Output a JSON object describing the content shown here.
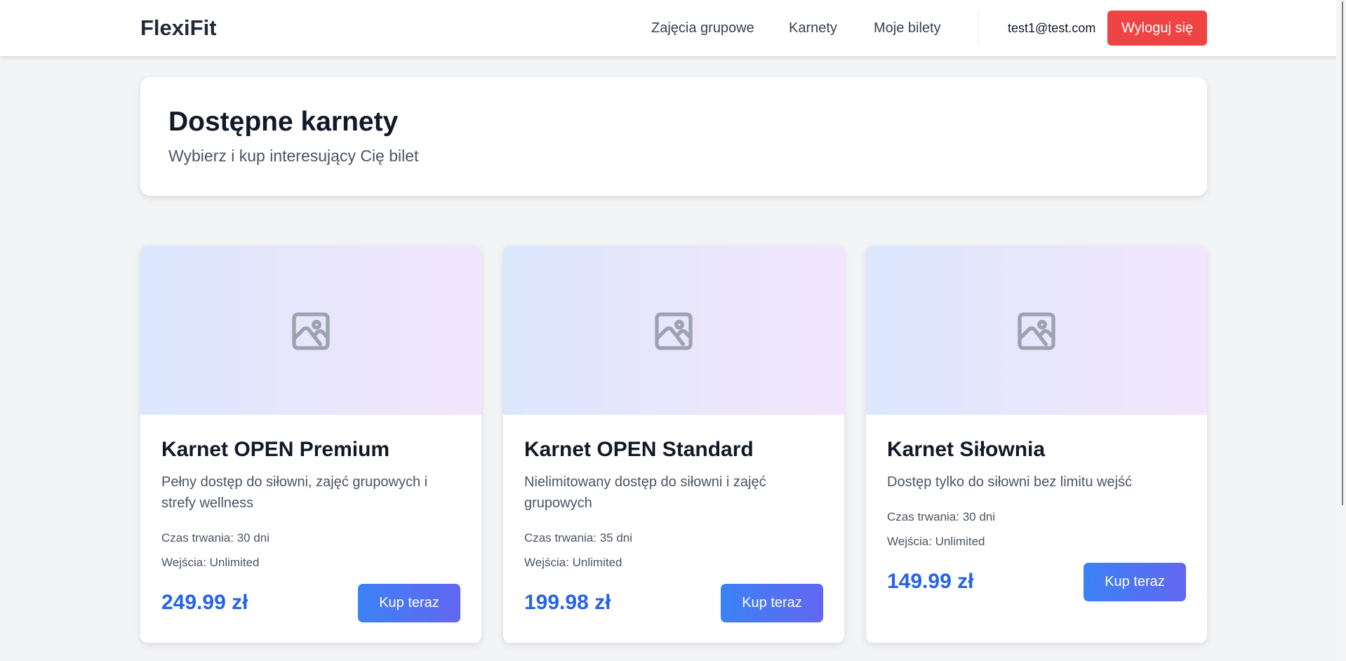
{
  "navbar": {
    "brand": "FlexiFit",
    "links": [
      {
        "label": "Zajęcia grupowe"
      },
      {
        "label": "Karnety"
      },
      {
        "label": "Moje bilety"
      }
    ],
    "user_email": "test1@test.com",
    "logout_label": "Wyloguj się"
  },
  "header": {
    "title": "Dostępne karnety",
    "subtitle": "Wybierz i kup interesujący Cię bilet"
  },
  "products": [
    {
      "title": "Karnet OPEN Premium",
      "description": "Pełny dostęp do siłowni, zajęć grupowych i strefy wellness",
      "duration": "Czas trwania: 30 dni",
      "entries": "Wejścia: Unlimited",
      "price": "249.99 zł",
      "buy_label": "Kup teraz",
      "image_icon": "image-placeholder-icon"
    },
    {
      "title": "Karnet OPEN Standard",
      "description": "Nielimitowany dostęp do siłowni i zajęć grupowych",
      "duration": "Czas trwania: 35 dni",
      "entries": "Wejścia: Unlimited",
      "price": "199.98 zł",
      "buy_label": "Kup teraz",
      "image_icon": "image-placeholder-icon"
    },
    {
      "title": "Karnet Siłownia",
      "description": "Dostęp tylko do siłowni bez limitu wejść",
      "duration": "Czas trwania: 30 dni",
      "entries": "Wejścia: Unlimited",
      "price": "149.99 zł",
      "buy_label": "Kup teraz",
      "image_icon": "image-placeholder-icon"
    }
  ],
  "colors": {
    "logout": "#ef4444",
    "price": "#2563eb",
    "buy_gradient_start": "#3b82f6",
    "buy_gradient_end": "#6366f1",
    "page_bg": "#f3f4f6"
  }
}
